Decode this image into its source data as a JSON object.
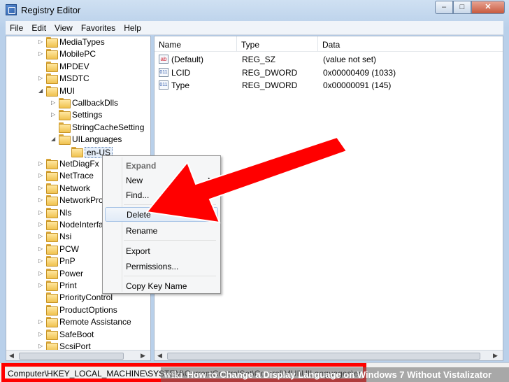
{
  "window": {
    "title": "Registry Editor",
    "controls": {
      "minimize": "–",
      "maximize": "□",
      "close": "✕"
    }
  },
  "menubar": [
    "File",
    "Edit",
    "View",
    "Favorites",
    "Help"
  ],
  "tree": [
    {
      "label": "MediaTypes",
      "expander": "collapsed"
    },
    {
      "label": "MobilePC",
      "expander": "collapsed"
    },
    {
      "label": "MPDEV",
      "expander": "none"
    },
    {
      "label": "MSDTC",
      "expander": "collapsed"
    },
    {
      "label": "MUI",
      "expander": "expanded"
    },
    {
      "label": "CallbackDlls",
      "expander": "collapsed"
    },
    {
      "label": "Settings",
      "expander": "collapsed"
    },
    {
      "label": "StringCacheSetting",
      "expander": "none"
    },
    {
      "label": "UILanguages",
      "expander": "expanded"
    },
    {
      "label": "en-US",
      "expander": "none",
      "selected": true
    },
    {
      "label": "NetDiagFx",
      "expander": "collapsed"
    },
    {
      "label": "NetTrace",
      "expander": "collapsed"
    },
    {
      "label": "Network",
      "expander": "collapsed"
    },
    {
      "label": "NetworkPro",
      "expander": "collapsed"
    },
    {
      "label": "Nls",
      "expander": "collapsed"
    },
    {
      "label": "NodeInterfa",
      "expander": "collapsed"
    },
    {
      "label": "Nsi",
      "expander": "collapsed"
    },
    {
      "label": "PCW",
      "expander": "collapsed"
    },
    {
      "label": "PnP",
      "expander": "collapsed"
    },
    {
      "label": "Power",
      "expander": "collapsed"
    },
    {
      "label": "Print",
      "expander": "collapsed"
    },
    {
      "label": "PriorityControl",
      "expander": "none"
    },
    {
      "label": "ProductOptions",
      "expander": "none"
    },
    {
      "label": "Remote Assistance",
      "expander": "collapsed"
    },
    {
      "label": "SafeBoot",
      "expander": "collapsed"
    },
    {
      "label": "ScsiPort",
      "expander": "collapsed"
    }
  ],
  "list": {
    "headers": {
      "name": "Name",
      "type": "Type",
      "data": "Data"
    },
    "rows": [
      {
        "icon": "string-value-icon",
        "glyph": "ab",
        "name": "(Default)",
        "type": "REG_SZ",
        "data": "(value not set)"
      },
      {
        "icon": "binary-value-icon",
        "glyph": "011",
        "name": "LCID",
        "type": "REG_DWORD",
        "data": "0x00000409 (1033)"
      },
      {
        "icon": "binary-value-icon",
        "glyph": "011",
        "name": "Type",
        "type": "REG_DWORD",
        "data": "0x00000091 (145)"
      }
    ]
  },
  "context_menu": {
    "items": [
      {
        "label": "Expand",
        "style": "bold"
      },
      {
        "label": "New",
        "submenu": "▶"
      },
      {
        "label": "Find..."
      },
      {
        "label": "Delete",
        "highlighted": true
      },
      {
        "label": "Rename"
      },
      {
        "label": "Export"
      },
      {
        "label": "Permissions..."
      },
      {
        "label": "Copy Key Name"
      }
    ]
  },
  "statusbar": {
    "path": "Computer\\HKEY_LOCAL_MACHINE\\SYSTEM\\CurrentControlSet\\Control\\MUI\\UILanguages\\en-US"
  },
  "caption": {
    "brand": "wiki",
    "text": "How to Change a Display Language on Windows 7 Without Vistalizator"
  },
  "colors": {
    "annotation_red": "#ff0000",
    "selection_blue": "#a8c4e6"
  }
}
